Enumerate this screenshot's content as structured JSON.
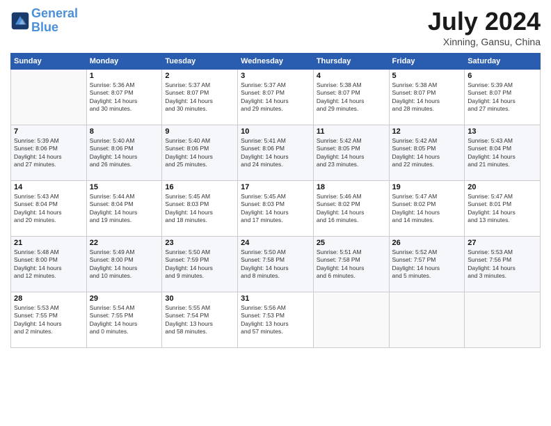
{
  "header": {
    "logo_line1": "General",
    "logo_line2": "Blue",
    "month": "July 2024",
    "location": "Xinning, Gansu, China"
  },
  "days_of_week": [
    "Sunday",
    "Monday",
    "Tuesday",
    "Wednesday",
    "Thursday",
    "Friday",
    "Saturday"
  ],
  "weeks": [
    [
      {
        "day": "",
        "info": ""
      },
      {
        "day": "1",
        "info": "Sunrise: 5:36 AM\nSunset: 8:07 PM\nDaylight: 14 hours\nand 30 minutes."
      },
      {
        "day": "2",
        "info": "Sunrise: 5:37 AM\nSunset: 8:07 PM\nDaylight: 14 hours\nand 30 minutes."
      },
      {
        "day": "3",
        "info": "Sunrise: 5:37 AM\nSunset: 8:07 PM\nDaylight: 14 hours\nand 29 minutes."
      },
      {
        "day": "4",
        "info": "Sunrise: 5:38 AM\nSunset: 8:07 PM\nDaylight: 14 hours\nand 29 minutes."
      },
      {
        "day": "5",
        "info": "Sunrise: 5:38 AM\nSunset: 8:07 PM\nDaylight: 14 hours\nand 28 minutes."
      },
      {
        "day": "6",
        "info": "Sunrise: 5:39 AM\nSunset: 8:07 PM\nDaylight: 14 hours\nand 27 minutes."
      }
    ],
    [
      {
        "day": "7",
        "info": "Sunrise: 5:39 AM\nSunset: 8:06 PM\nDaylight: 14 hours\nand 27 minutes."
      },
      {
        "day": "8",
        "info": "Sunrise: 5:40 AM\nSunset: 8:06 PM\nDaylight: 14 hours\nand 26 minutes."
      },
      {
        "day": "9",
        "info": "Sunrise: 5:40 AM\nSunset: 8:06 PM\nDaylight: 14 hours\nand 25 minutes."
      },
      {
        "day": "10",
        "info": "Sunrise: 5:41 AM\nSunset: 8:06 PM\nDaylight: 14 hours\nand 24 minutes."
      },
      {
        "day": "11",
        "info": "Sunrise: 5:42 AM\nSunset: 8:05 PM\nDaylight: 14 hours\nand 23 minutes."
      },
      {
        "day": "12",
        "info": "Sunrise: 5:42 AM\nSunset: 8:05 PM\nDaylight: 14 hours\nand 22 minutes."
      },
      {
        "day": "13",
        "info": "Sunrise: 5:43 AM\nSunset: 8:04 PM\nDaylight: 14 hours\nand 21 minutes."
      }
    ],
    [
      {
        "day": "14",
        "info": "Sunrise: 5:43 AM\nSunset: 8:04 PM\nDaylight: 14 hours\nand 20 minutes."
      },
      {
        "day": "15",
        "info": "Sunrise: 5:44 AM\nSunset: 8:04 PM\nDaylight: 14 hours\nand 19 minutes."
      },
      {
        "day": "16",
        "info": "Sunrise: 5:45 AM\nSunset: 8:03 PM\nDaylight: 14 hours\nand 18 minutes."
      },
      {
        "day": "17",
        "info": "Sunrise: 5:45 AM\nSunset: 8:03 PM\nDaylight: 14 hours\nand 17 minutes."
      },
      {
        "day": "18",
        "info": "Sunrise: 5:46 AM\nSunset: 8:02 PM\nDaylight: 14 hours\nand 16 minutes."
      },
      {
        "day": "19",
        "info": "Sunrise: 5:47 AM\nSunset: 8:02 PM\nDaylight: 14 hours\nand 14 minutes."
      },
      {
        "day": "20",
        "info": "Sunrise: 5:47 AM\nSunset: 8:01 PM\nDaylight: 14 hours\nand 13 minutes."
      }
    ],
    [
      {
        "day": "21",
        "info": "Sunrise: 5:48 AM\nSunset: 8:00 PM\nDaylight: 14 hours\nand 12 minutes."
      },
      {
        "day": "22",
        "info": "Sunrise: 5:49 AM\nSunset: 8:00 PM\nDaylight: 14 hours\nand 10 minutes."
      },
      {
        "day": "23",
        "info": "Sunrise: 5:50 AM\nSunset: 7:59 PM\nDaylight: 14 hours\nand 9 minutes."
      },
      {
        "day": "24",
        "info": "Sunrise: 5:50 AM\nSunset: 7:58 PM\nDaylight: 14 hours\nand 8 minutes."
      },
      {
        "day": "25",
        "info": "Sunrise: 5:51 AM\nSunset: 7:58 PM\nDaylight: 14 hours\nand 6 minutes."
      },
      {
        "day": "26",
        "info": "Sunrise: 5:52 AM\nSunset: 7:57 PM\nDaylight: 14 hours\nand 5 minutes."
      },
      {
        "day": "27",
        "info": "Sunrise: 5:53 AM\nSunset: 7:56 PM\nDaylight: 14 hours\nand 3 minutes."
      }
    ],
    [
      {
        "day": "28",
        "info": "Sunrise: 5:53 AM\nSunset: 7:55 PM\nDaylight: 14 hours\nand 2 minutes."
      },
      {
        "day": "29",
        "info": "Sunrise: 5:54 AM\nSunset: 7:55 PM\nDaylight: 14 hours\nand 0 minutes."
      },
      {
        "day": "30",
        "info": "Sunrise: 5:55 AM\nSunset: 7:54 PM\nDaylight: 13 hours\nand 58 minutes."
      },
      {
        "day": "31",
        "info": "Sunrise: 5:56 AM\nSunset: 7:53 PM\nDaylight: 13 hours\nand 57 minutes."
      },
      {
        "day": "",
        "info": ""
      },
      {
        "day": "",
        "info": ""
      },
      {
        "day": "",
        "info": ""
      }
    ]
  ]
}
